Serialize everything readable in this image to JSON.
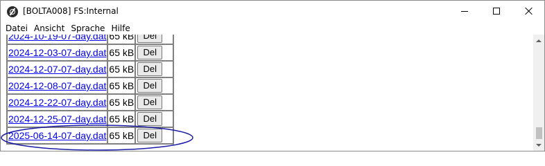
{
  "window": {
    "title": "[BOLTA008] FS:Internal",
    "icon": "app-logo-icon"
  },
  "menu": [
    "Datei",
    "Ansicht",
    "Sprache",
    "Hilfe"
  ],
  "files": [
    {
      "name": "2024-10-19-07-day.dat",
      "size": "65 kB",
      "action": "Del"
    },
    {
      "name": "2024-12-03-07-day.dat",
      "size": "65 kB",
      "action": "Del"
    },
    {
      "name": "2024-12-07-07-day.dat",
      "size": "65 kB",
      "action": "Del"
    },
    {
      "name": "2024-12-08-07-day.dat",
      "size": "65 kB",
      "action": "Del"
    },
    {
      "name": "2024-12-22-07-day.dat",
      "size": "65 kB",
      "action": "Del"
    },
    {
      "name": "2024-12-25-07-day.dat",
      "size": "65 kB",
      "action": "Del"
    },
    {
      "name": "2025-06-14-07-day.dat",
      "size": "65 kB",
      "action": "Del"
    }
  ],
  "colors": {
    "link": "#0000ee",
    "annotation": "#1a1aa6"
  }
}
